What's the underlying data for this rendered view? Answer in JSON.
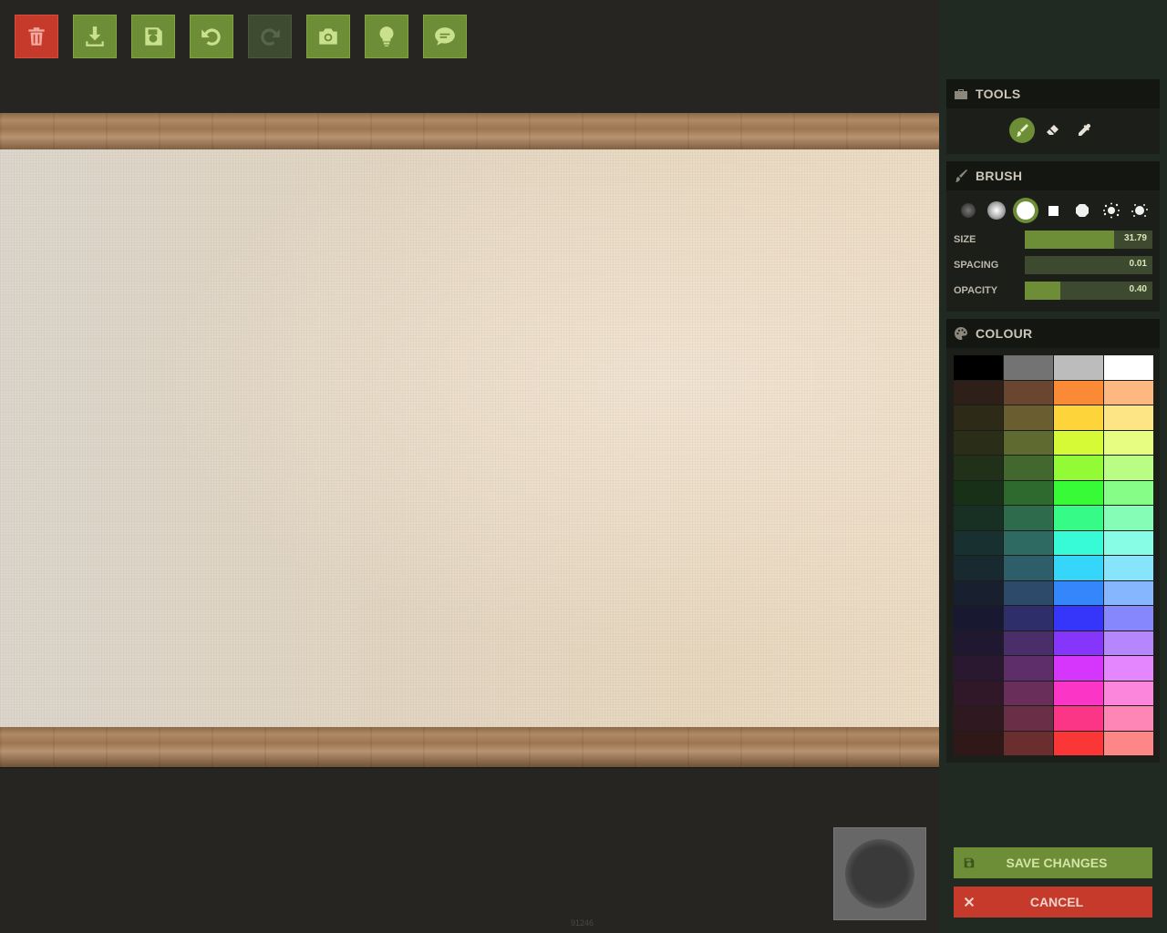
{
  "toolbar": {
    "buttons": [
      {
        "name": "trash-button",
        "icon": "trash-icon",
        "color": "#c53a2b",
        "enabled": true
      },
      {
        "name": "download-button",
        "icon": "download-icon",
        "color": "#6d8e36",
        "enabled": true
      },
      {
        "name": "save-button",
        "icon": "floppy-icon",
        "color": "#6d8e36",
        "enabled": true
      },
      {
        "name": "undo-button",
        "icon": "undo-icon",
        "color": "#6d8e36",
        "enabled": true
      },
      {
        "name": "redo-button",
        "icon": "redo-icon",
        "color": "#3e4b30",
        "enabled": false
      },
      {
        "name": "camera-button",
        "icon": "camera-icon",
        "color": "#6d8e36",
        "enabled": true
      },
      {
        "name": "lightbulb-button",
        "icon": "lightbulb-icon",
        "color": "#6d8e36",
        "enabled": true
      },
      {
        "name": "chat-button",
        "icon": "chat-icon",
        "color": "#6d8e36",
        "enabled": true
      }
    ]
  },
  "tools": {
    "title": "TOOLS",
    "icon": "toolbox-icon",
    "items": [
      {
        "name": "brush-tool",
        "icon": "brush-icon",
        "active": true
      },
      {
        "name": "eraser-tool",
        "icon": "eraser-icon",
        "active": false
      },
      {
        "name": "eyedropper-tool",
        "icon": "eyedropper-icon",
        "active": false
      }
    ]
  },
  "brush": {
    "title": "BRUSH",
    "icon": "paintbrush-icon",
    "shapes": [
      "soft-small",
      "soft-medium",
      "circle-hard",
      "square",
      "octagon",
      "splatter",
      "splatter-2"
    ],
    "active_shape": 2,
    "sliders": [
      {
        "label": "SIZE",
        "value": "31.79",
        "fraction": 0.7
      },
      {
        "label": "SPACING",
        "value": "0.01",
        "fraction": 0.0
      },
      {
        "label": "OPACITY",
        "value": "0.40",
        "fraction": 0.28
      }
    ]
  },
  "colour": {
    "title": "COLOUR",
    "icon": "palette-icon",
    "swatches": [
      "#000000",
      "#737373",
      "#bcbcbc",
      "#ffffff",
      "#2e1f18",
      "#6a4530",
      "#fb8a36",
      "#fdb882",
      "#2e2a18",
      "#6a5e30",
      "#fdd43a",
      "#fde586",
      "#2a2e18",
      "#5e6a30",
      "#d6fb36",
      "#e6fd82",
      "#213018",
      "#43682f",
      "#93fb36",
      "#bafd84",
      "#183018",
      "#2e6a2e",
      "#36fb36",
      "#86fd86",
      "#183024",
      "#2e6a4c",
      "#36fb86",
      "#86fdb6",
      "#183030",
      "#2e6a62",
      "#36fbd6",
      "#86fde4",
      "#182a30",
      "#2e5e6a",
      "#36d6fb",
      "#86e4fd",
      "#182030",
      "#2e4a6a",
      "#3686fb",
      "#86b6fd",
      "#181830",
      "#2e2e6a",
      "#3636fb",
      "#8686fd",
      "#201830",
      "#4a2e6a",
      "#8636fb",
      "#b686fd",
      "#2a1830",
      "#5e2e6a",
      "#d636fb",
      "#e486fd",
      "#301828",
      "#6a2e5a",
      "#fb36c6",
      "#fd86dd",
      "#301820",
      "#6a2e46",
      "#fb3686",
      "#fd86b6",
      "#301818",
      "#6a2e2e",
      "#fb3636",
      "#fd8686"
    ]
  },
  "actions": {
    "save_label": "SAVE CHANGES",
    "cancel_label": "CANCEL"
  },
  "footer": {
    "id_text": "91246"
  }
}
